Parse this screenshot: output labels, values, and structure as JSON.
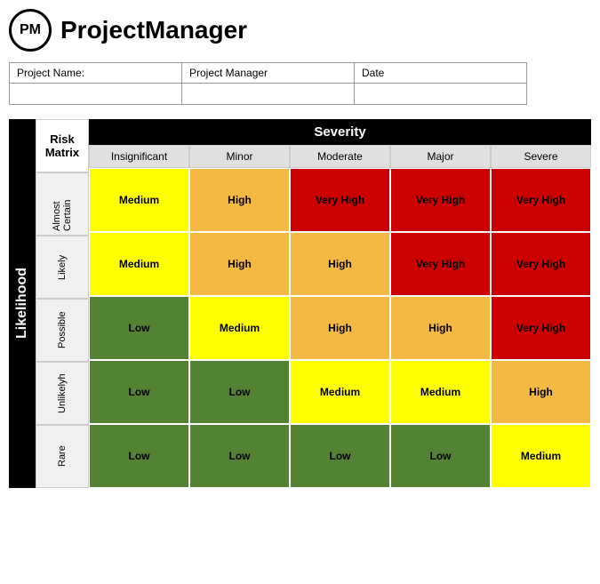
{
  "header": {
    "logo_text": "PM",
    "title": "ProjectManager"
  },
  "project_form": {
    "labels": [
      "Project Name:",
      "Project Manager",
      "Date"
    ],
    "values": [
      "",
      "",
      ""
    ]
  },
  "matrix": {
    "likelihood_label": "Likelihood",
    "risk_matrix_label": "Risk Matrix",
    "severity_label": "Severity",
    "col_headers": [
      "Insignificant",
      "Minor",
      "Moderate",
      "Major",
      "Severe"
    ],
    "rows": [
      {
        "label": "Almost Certain",
        "cells": [
          {
            "text": "Medium",
            "class": "cell-medium"
          },
          {
            "text": "High",
            "class": "cell-high"
          },
          {
            "text": "Very High",
            "class": "cell-very-high"
          },
          {
            "text": "Very High",
            "class": "cell-very-high"
          },
          {
            "text": "Very High",
            "class": "cell-very-high"
          }
        ]
      },
      {
        "label": "Likely",
        "cells": [
          {
            "text": "Medium",
            "class": "cell-medium"
          },
          {
            "text": "High",
            "class": "cell-high"
          },
          {
            "text": "High",
            "class": "cell-high"
          },
          {
            "text": "Very High",
            "class": "cell-very-high"
          },
          {
            "text": "Very High",
            "class": "cell-very-high"
          }
        ]
      },
      {
        "label": "Possible",
        "cells": [
          {
            "text": "Low",
            "class": "cell-low"
          },
          {
            "text": "Medium",
            "class": "cell-medium"
          },
          {
            "text": "High",
            "class": "cell-high"
          },
          {
            "text": "High",
            "class": "cell-high"
          },
          {
            "text": "Very High",
            "class": "cell-very-high"
          }
        ]
      },
      {
        "label": "Unlikelyh",
        "cells": [
          {
            "text": "Low",
            "class": "cell-low"
          },
          {
            "text": "Low",
            "class": "cell-low"
          },
          {
            "text": "Medium",
            "class": "cell-medium"
          },
          {
            "text": "Medium",
            "class": "cell-medium"
          },
          {
            "text": "High",
            "class": "cell-high-orange"
          }
        ]
      },
      {
        "label": "Rare",
        "cells": [
          {
            "text": "Low",
            "class": "cell-low"
          },
          {
            "text": "Low",
            "class": "cell-low"
          },
          {
            "text": "Low",
            "class": "cell-low"
          },
          {
            "text": "Low",
            "class": "cell-low"
          },
          {
            "text": "Medium",
            "class": "cell-medium"
          }
        ]
      }
    ]
  }
}
